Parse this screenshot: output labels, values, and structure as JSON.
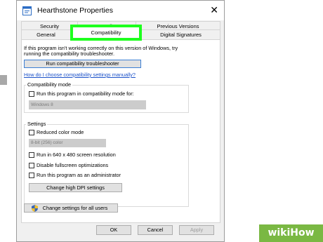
{
  "window": {
    "title": "Hearthstone Properties",
    "close": "✕"
  },
  "tabs": {
    "row1": [
      "Security",
      "Details",
      "Previous Versions"
    ],
    "row2": [
      "General",
      "Compatibility",
      "Digital Signatures"
    ],
    "active": "Compatibility"
  },
  "intro": {
    "text1": "If this program isn't working correctly on this version of Windows, try",
    "text2": "running the compatibility troubleshooter.",
    "run_button": "Run compatibility troubleshooter",
    "manual_link": "How do I choose compatibility settings manually?"
  },
  "compat_mode": {
    "legend": "Compatibility mode",
    "checkbox_label": "Run this program in compatibility mode for:",
    "select_value": "Windows 8"
  },
  "settings": {
    "legend": "Settings",
    "reduced_color": "Reduced color mode",
    "color_select": "8-bit (256) color",
    "res_640": "Run in 640 x 480 screen resolution",
    "disable_fullscreen": "Disable fullscreen optimizations",
    "run_admin": "Run this program as an administrator",
    "dpi_button": "Change high DPI settings"
  },
  "all_users_button": "Change settings for all users",
  "footer": {
    "ok": "OK",
    "cancel": "Cancel",
    "apply": "Apply"
  },
  "watermark": {
    "text": "wikiHow"
  },
  "colors": {
    "highlight": "#1eff1e",
    "link": "#1c52c9",
    "watermark": "#7ab843"
  }
}
